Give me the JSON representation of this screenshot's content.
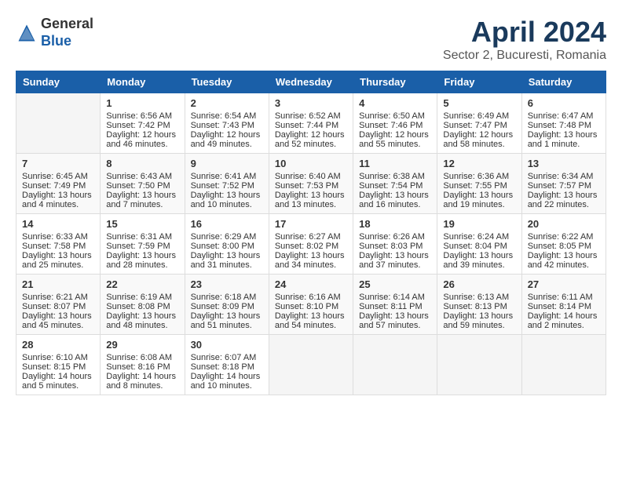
{
  "header": {
    "logo_general": "General",
    "logo_blue": "Blue",
    "title": "April 2024",
    "subtitle": "Sector 2, Bucuresti, Romania"
  },
  "weekdays": [
    "Sunday",
    "Monday",
    "Tuesday",
    "Wednesday",
    "Thursday",
    "Friday",
    "Saturday"
  ],
  "weeks": [
    [
      {
        "day": "",
        "sunrise": "",
        "sunset": "",
        "daylight": ""
      },
      {
        "day": "1",
        "sunrise": "Sunrise: 6:56 AM",
        "sunset": "Sunset: 7:42 PM",
        "daylight": "Daylight: 12 hours and 46 minutes."
      },
      {
        "day": "2",
        "sunrise": "Sunrise: 6:54 AM",
        "sunset": "Sunset: 7:43 PM",
        "daylight": "Daylight: 12 hours and 49 minutes."
      },
      {
        "day": "3",
        "sunrise": "Sunrise: 6:52 AM",
        "sunset": "Sunset: 7:44 PM",
        "daylight": "Daylight: 12 hours and 52 minutes."
      },
      {
        "day": "4",
        "sunrise": "Sunrise: 6:50 AM",
        "sunset": "Sunset: 7:46 PM",
        "daylight": "Daylight: 12 hours and 55 minutes."
      },
      {
        "day": "5",
        "sunrise": "Sunrise: 6:49 AM",
        "sunset": "Sunset: 7:47 PM",
        "daylight": "Daylight: 12 hours and 58 minutes."
      },
      {
        "day": "6",
        "sunrise": "Sunrise: 6:47 AM",
        "sunset": "Sunset: 7:48 PM",
        "daylight": "Daylight: 13 hours and 1 minute."
      }
    ],
    [
      {
        "day": "7",
        "sunrise": "Sunrise: 6:45 AM",
        "sunset": "Sunset: 7:49 PM",
        "daylight": "Daylight: 13 hours and 4 minutes."
      },
      {
        "day": "8",
        "sunrise": "Sunrise: 6:43 AM",
        "sunset": "Sunset: 7:50 PM",
        "daylight": "Daylight: 13 hours and 7 minutes."
      },
      {
        "day": "9",
        "sunrise": "Sunrise: 6:41 AM",
        "sunset": "Sunset: 7:52 PM",
        "daylight": "Daylight: 13 hours and 10 minutes."
      },
      {
        "day": "10",
        "sunrise": "Sunrise: 6:40 AM",
        "sunset": "Sunset: 7:53 PM",
        "daylight": "Daylight: 13 hours and 13 minutes."
      },
      {
        "day": "11",
        "sunrise": "Sunrise: 6:38 AM",
        "sunset": "Sunset: 7:54 PM",
        "daylight": "Daylight: 13 hours and 16 minutes."
      },
      {
        "day": "12",
        "sunrise": "Sunrise: 6:36 AM",
        "sunset": "Sunset: 7:55 PM",
        "daylight": "Daylight: 13 hours and 19 minutes."
      },
      {
        "day": "13",
        "sunrise": "Sunrise: 6:34 AM",
        "sunset": "Sunset: 7:57 PM",
        "daylight": "Daylight: 13 hours and 22 minutes."
      }
    ],
    [
      {
        "day": "14",
        "sunrise": "Sunrise: 6:33 AM",
        "sunset": "Sunset: 7:58 PM",
        "daylight": "Daylight: 13 hours and 25 minutes."
      },
      {
        "day": "15",
        "sunrise": "Sunrise: 6:31 AM",
        "sunset": "Sunset: 7:59 PM",
        "daylight": "Daylight: 13 hours and 28 minutes."
      },
      {
        "day": "16",
        "sunrise": "Sunrise: 6:29 AM",
        "sunset": "Sunset: 8:00 PM",
        "daylight": "Daylight: 13 hours and 31 minutes."
      },
      {
        "day": "17",
        "sunrise": "Sunrise: 6:27 AM",
        "sunset": "Sunset: 8:02 PM",
        "daylight": "Daylight: 13 hours and 34 minutes."
      },
      {
        "day": "18",
        "sunrise": "Sunrise: 6:26 AM",
        "sunset": "Sunset: 8:03 PM",
        "daylight": "Daylight: 13 hours and 37 minutes."
      },
      {
        "day": "19",
        "sunrise": "Sunrise: 6:24 AM",
        "sunset": "Sunset: 8:04 PM",
        "daylight": "Daylight: 13 hours and 39 minutes."
      },
      {
        "day": "20",
        "sunrise": "Sunrise: 6:22 AM",
        "sunset": "Sunset: 8:05 PM",
        "daylight": "Daylight: 13 hours and 42 minutes."
      }
    ],
    [
      {
        "day": "21",
        "sunrise": "Sunrise: 6:21 AM",
        "sunset": "Sunset: 8:07 PM",
        "daylight": "Daylight: 13 hours and 45 minutes."
      },
      {
        "day": "22",
        "sunrise": "Sunrise: 6:19 AM",
        "sunset": "Sunset: 8:08 PM",
        "daylight": "Daylight: 13 hours and 48 minutes."
      },
      {
        "day": "23",
        "sunrise": "Sunrise: 6:18 AM",
        "sunset": "Sunset: 8:09 PM",
        "daylight": "Daylight: 13 hours and 51 minutes."
      },
      {
        "day": "24",
        "sunrise": "Sunrise: 6:16 AM",
        "sunset": "Sunset: 8:10 PM",
        "daylight": "Daylight: 13 hours and 54 minutes."
      },
      {
        "day": "25",
        "sunrise": "Sunrise: 6:14 AM",
        "sunset": "Sunset: 8:11 PM",
        "daylight": "Daylight: 13 hours and 57 minutes."
      },
      {
        "day": "26",
        "sunrise": "Sunrise: 6:13 AM",
        "sunset": "Sunset: 8:13 PM",
        "daylight": "Daylight: 13 hours and 59 minutes."
      },
      {
        "day": "27",
        "sunrise": "Sunrise: 6:11 AM",
        "sunset": "Sunset: 8:14 PM",
        "daylight": "Daylight: 14 hours and 2 minutes."
      }
    ],
    [
      {
        "day": "28",
        "sunrise": "Sunrise: 6:10 AM",
        "sunset": "Sunset: 8:15 PM",
        "daylight": "Daylight: 14 hours and 5 minutes."
      },
      {
        "day": "29",
        "sunrise": "Sunrise: 6:08 AM",
        "sunset": "Sunset: 8:16 PM",
        "daylight": "Daylight: 14 hours and 8 minutes."
      },
      {
        "day": "30",
        "sunrise": "Sunrise: 6:07 AM",
        "sunset": "Sunset: 8:18 PM",
        "daylight": "Daylight: 14 hours and 10 minutes."
      },
      {
        "day": "",
        "sunrise": "",
        "sunset": "",
        "daylight": ""
      },
      {
        "day": "",
        "sunrise": "",
        "sunset": "",
        "daylight": ""
      },
      {
        "day": "",
        "sunrise": "",
        "sunset": "",
        "daylight": ""
      },
      {
        "day": "",
        "sunrise": "",
        "sunset": "",
        "daylight": ""
      }
    ]
  ]
}
